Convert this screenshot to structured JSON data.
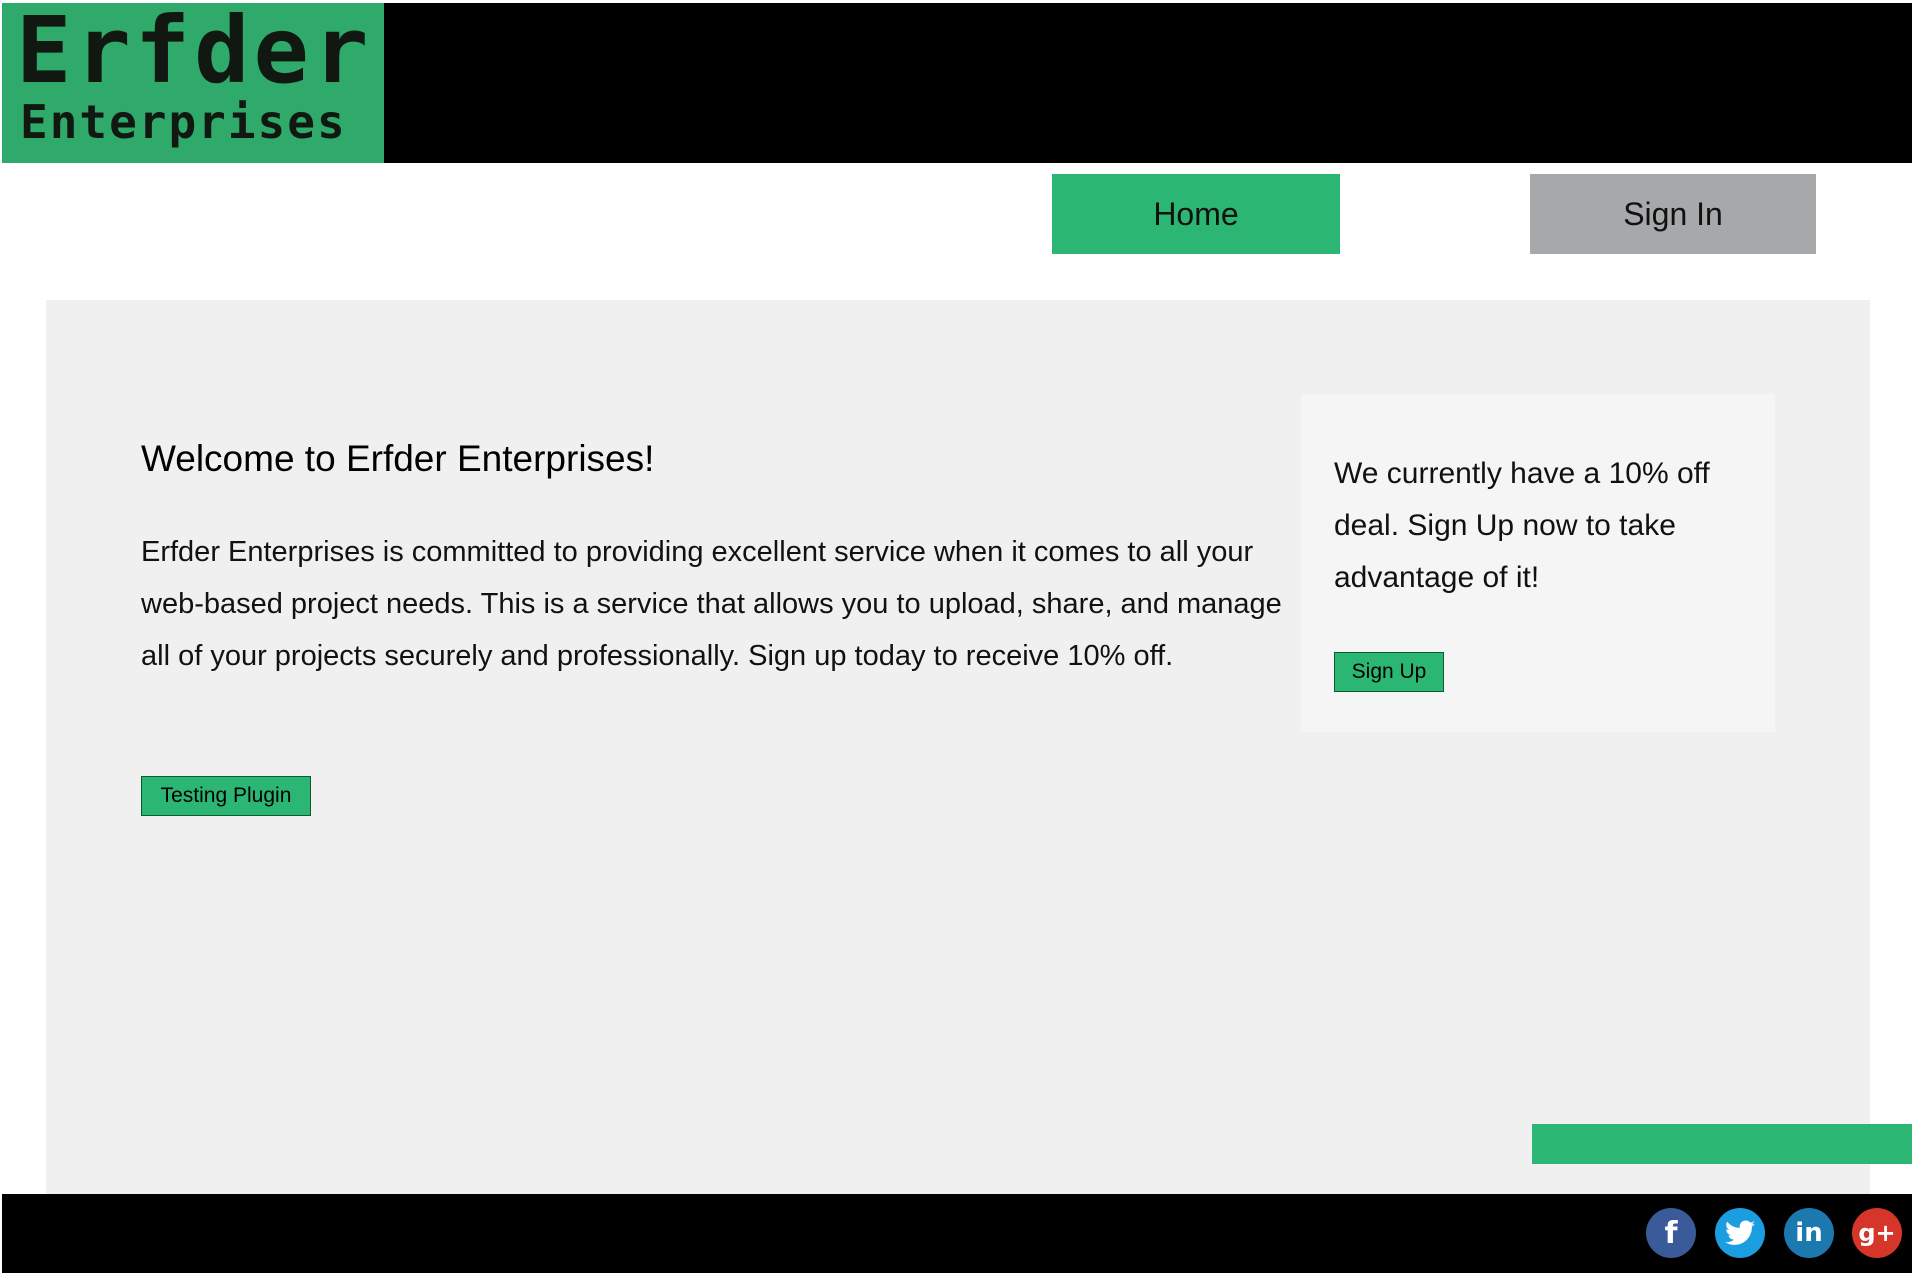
{
  "logo": {
    "line1": "Erfder",
    "line2": "Enterprises",
    "color": "#2faa6a"
  },
  "nav": {
    "home_label": "Home",
    "signin_label": "Sign In"
  },
  "main": {
    "title": "Welcome to Erfder Enterprises!",
    "body": "Erfder Enterprises is committed to providing excellent service when it comes to all your web-based project needs. This is a service that allows you to upload, share, and manage all of your projects securely and professionally. Sign up today to receive 10% off.",
    "testing_button": "Testing Plugin"
  },
  "promo": {
    "text": "We currently have a 10% off deal. Sign Up now to take advantage of it!",
    "signup_button": "Sign Up"
  },
  "footer": {
    "social": {
      "facebook_glyph": "f",
      "twitter_glyph": "🐦",
      "linkedin_glyph": "in",
      "googleplus_glyph": "g+"
    },
    "icons": [
      "facebook-icon",
      "twitter-icon",
      "linkedin-icon",
      "google-plus-icon"
    ]
  },
  "colors": {
    "accent_green": "#2cb673",
    "nav_gray": "#a7a8aa",
    "header_bg": "#000000",
    "panel_bg": "#f0f0f0"
  }
}
